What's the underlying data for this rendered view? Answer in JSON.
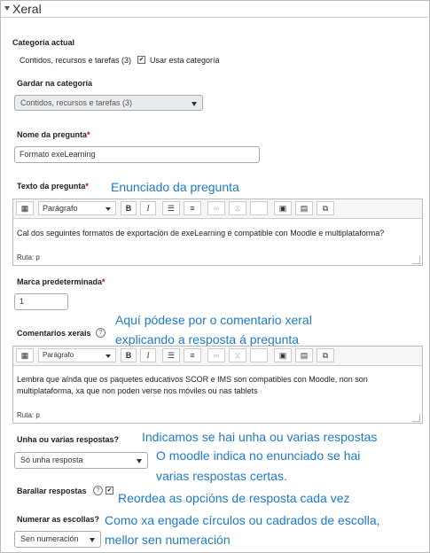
{
  "section": {
    "title": "Xeral"
  },
  "category": {
    "label": "Categoría actual",
    "value": "Contidos, recursos e tarefas (3)",
    "use_label": "Usar esta categoría"
  },
  "save_in": {
    "label": "Gardar na categoría",
    "value": "Contidos, recursos e tarefas (3)"
  },
  "question_name": {
    "label": "Nome da pregunta",
    "value": "Formato exeLearning"
  },
  "question_text": {
    "label": "Texto da pregunta",
    "format": "Parágrafo",
    "path": "Ruta: p",
    "body": "Cal dos seguintes formatos de exportación de exeLearning é compatible con Moodle e multiplataforma?",
    "note": "Enunciado da pregunta"
  },
  "default_mark": {
    "label": "Marca predeterminada",
    "value": "1"
  },
  "feedback": {
    "label": "Comentarios xerais",
    "format": "Parágrafo",
    "path": "Ruta: p",
    "line1": "Lembra que aínda que os paquetes educativos SCOR e IMS son compatibles con Moodle, non son",
    "line2": "multiplataforma, xa que non poden verse nos móviles ou nas tablets",
    "note1": "Aquí pódese por o comentario xeral",
    "note2": "explicando a resposta á pregunta"
  },
  "single": {
    "label": "Unha ou varias respostas?",
    "value": "Só unha resposta",
    "note1": "Indicamos se hai unha ou varias respostas",
    "note2": "O moodle indica no enunciado se hai",
    "note3": "varias respostas certas."
  },
  "shuffle": {
    "label": "Barallar respostas",
    "note": "Reordea as opcións de resposta cada vez"
  },
  "numbering": {
    "label": "Numerar as escollas?",
    "value": "Sen numeración",
    "note1": "Como xa engade círculos ou cadrados de escolla,",
    "note2": "mellor sen numeración"
  },
  "required_mark": "*",
  "check_glyph": "✔",
  "help_glyph": "?",
  "accent_color": "#1e7ac8"
}
